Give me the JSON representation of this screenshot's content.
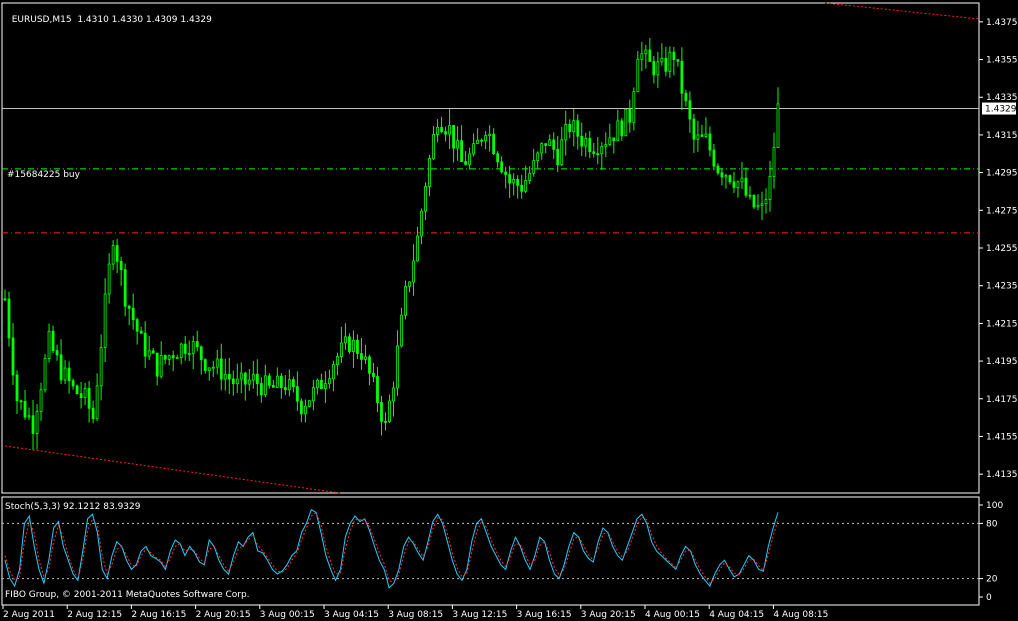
{
  "chart_data": [
    {
      "type": "candlestick",
      "title": "EURUSD,M15",
      "ohlc_header": "1.4310 1.4330 1.4309 1.4329",
      "symbol": "EURUSD",
      "timeframe": "M15",
      "last_price": "1.4329",
      "ylim": [
        1.4125,
        1.4385
      ],
      "y_ticks": [
        "1.4375",
        "1.4355",
        "1.4335",
        "1.4315",
        "1.4295",
        "1.4275",
        "1.4255",
        "1.4235",
        "1.4215",
        "1.4195",
        "1.4175",
        "1.4155",
        "1.4135"
      ],
      "x_ticks": [
        "2 Aug 2011",
        "2 Aug 12:15",
        "2 Aug 16:15",
        "2 Aug 20:15",
        "3 Aug 00:15",
        "3 Aug 04:15",
        "3 Aug 08:15",
        "3 Aug 12:15",
        "3 Aug 16:15",
        "3 Aug 20:15",
        "4 Aug 00:15",
        "4 Aug 04:15",
        "4 Aug 08:15"
      ],
      "order_label": "#15684225 buy",
      "order_price": 1.4297,
      "stop_loss": 1.4263,
      "bid_line": 1.4329,
      "price_path": [
        [
          0,
          1.4228
        ],
        [
          3,
          1.4175
        ],
        [
          7,
          1.4162
        ],
        [
          11,
          1.4205
        ],
        [
          14,
          1.419
        ],
        [
          17,
          1.418
        ],
        [
          20,
          1.4175
        ],
        [
          22,
          1.4165
        ],
        [
          25,
          1.4225
        ],
        [
          27,
          1.4262
        ],
        [
          30,
          1.423
        ],
        [
          34,
          1.4205
        ],
        [
          38,
          1.4192
        ],
        [
          42,
          1.42
        ],
        [
          46,
          1.4205
        ],
        [
          50,
          1.4195
        ],
        [
          54,
          1.419
        ],
        [
          58,
          1.4182
        ],
        [
          62,
          1.4185
        ],
        [
          66,
          1.418
        ],
        [
          70,
          1.4183
        ],
        [
          74,
          1.4172
        ],
        [
          78,
          1.418
        ],
        [
          82,
          1.4195
        ],
        [
          86,
          1.4205
        ],
        [
          89,
          1.42
        ],
        [
          93,
          1.4175
        ],
        [
          95,
          1.416
        ],
        [
          97,
          1.4185
        ],
        [
          100,
          1.423
        ],
        [
          103,
          1.426
        ],
        [
          105,
          1.429
        ],
        [
          108,
          1.4325
        ],
        [
          111,
          1.4318
        ],
        [
          114,
          1.43
        ],
        [
          117,
          1.4305
        ],
        [
          120,
          1.432
        ],
        [
          123,
          1.4305
        ],
        [
          126,
          1.429
        ],
        [
          129,
          1.4288
        ],
        [
          132,
          1.4298
        ],
        [
          135,
          1.4312
        ],
        [
          138,
          1.4305
        ],
        [
          141,
          1.432
        ],
        [
          144,
          1.4313
        ],
        [
          147,
          1.431
        ],
        [
          150,
          1.4313
        ],
        [
          153,
          1.4318
        ],
        [
          156,
          1.4325
        ],
        [
          158,
          1.436
        ],
        [
          161,
          1.4352
        ],
        [
          164,
          1.435
        ],
        [
          167,
          1.4358
        ],
        [
          170,
          1.433
        ],
        [
          172,
          1.4312
        ],
        [
          175,
          1.4312
        ],
        [
          178,
          1.4298
        ],
        [
          181,
          1.4294
        ],
        [
          184,
          1.4288
        ],
        [
          186,
          1.4278
        ],
        [
          189,
          1.4275
        ],
        [
          191,
          1.429
        ],
        [
          193,
          1.4329
        ]
      ]
    },
    {
      "type": "line",
      "title": "Stoch(5,3,3) 92.1212 83.9329",
      "ylim": [
        0,
        100
      ],
      "y_ticks": [
        "100",
        "80",
        "20",
        "0"
      ],
      "levels": [
        80,
        20
      ],
      "series": [
        {
          "name": "main",
          "color": "#20d0ff",
          "values": [
            40,
            20,
            12,
            30,
            80,
            88,
            55,
            30,
            15,
            40,
            75,
            82,
            55,
            40,
            25,
            18,
            50,
            85,
            90,
            70,
            30,
            20,
            45,
            60,
            55,
            40,
            30,
            35,
            50,
            55,
            45,
            42,
            38,
            30,
            50,
            62,
            58,
            45,
            55,
            48,
            38,
            35,
            62,
            55,
            40,
            30,
            25,
            45,
            60,
            55,
            65,
            70,
            50,
            48,
            40,
            30,
            25,
            28,
            35,
            45,
            50,
            70,
            80,
            95,
            92,
            70,
            45,
            30,
            18,
            30,
            65,
            80,
            88,
            82,
            85,
            72,
            55,
            40,
            30,
            10,
            15,
            30,
            55,
            65,
            58,
            48,
            40,
            60,
            82,
            90,
            80,
            60,
            40,
            25,
            18,
            30,
            60,
            80,
            85,
            70,
            55,
            45,
            35,
            30,
            50,
            65,
            55,
            40,
            30,
            45,
            65,
            60,
            40,
            25,
            20,
            35,
            55,
            70,
            65,
            50,
            42,
            38,
            60,
            75,
            70,
            55,
            45,
            40,
            55,
            70,
            85,
            90,
            80,
            60,
            50,
            45,
            40,
            35,
            30,
            45,
            55,
            50,
            35,
            25,
            18,
            12,
            25,
            35,
            40,
            30,
            22,
            25,
            35,
            45,
            40,
            30,
            28,
            55,
            75,
            92
          ]
        },
        {
          "name": "signal",
          "color": "#ff3030",
          "dashed": true,
          "values": [
            45,
            28,
            18,
            22,
            60,
            82,
            70,
            40,
            22,
            30,
            60,
            78,
            65,
            45,
            30,
            20,
            40,
            72,
            85,
            78,
            45,
            25,
            35,
            52,
            55,
            45,
            35,
            33,
            45,
            52,
            48,
            43,
            40,
            33,
            42,
            55,
            58,
            50,
            52,
            50,
            42,
            37,
            52,
            55,
            45,
            35,
            28,
            38,
            52,
            56,
            62,
            68,
            56,
            50,
            43,
            35,
            28,
            27,
            31,
            40,
            47,
            62,
            75,
            88,
            92,
            78,
            55,
            38,
            25,
            26,
            52,
            72,
            84,
            84,
            84,
            76,
            62,
            48,
            36,
            18,
            15,
            25,
            45,
            60,
            60,
            52,
            44,
            54,
            74,
            86,
            84,
            68,
            48,
            32,
            22,
            26,
            48,
            70,
            82,
            76,
            62,
            50,
            40,
            33,
            44,
            58,
            57,
            46,
            35,
            40,
            56,
            60,
            48,
            32,
            24,
            30,
            47,
            63,
            66,
            56,
            46,
            40,
            53,
            68,
            71,
            60,
            50,
            43,
            50,
            63,
            78,
            87,
            84,
            68,
            56,
            48,
            42,
            37,
            32,
            40,
            50,
            51,
            40,
            30,
            22,
            15,
            20,
            30,
            37,
            33,
            26,
            24,
            31,
            40,
            41,
            34,
            29,
            46,
            66,
            84
          ]
        }
      ]
    }
  ],
  "copyright": "FIBO Group, © 2001-2011 MetaQuotes Software Corp.",
  "colors": {
    "background": "#000000",
    "candle": "#00ff00",
    "axis": "#ffffff",
    "grid_text": "#ffffff",
    "trend": "#ff2020",
    "stop": "#ff2020",
    "order": "#00ff00",
    "bid": "#c0c0c0",
    "stoch_main": "#20d0ff",
    "stoch_signal": "#ff3030"
  }
}
